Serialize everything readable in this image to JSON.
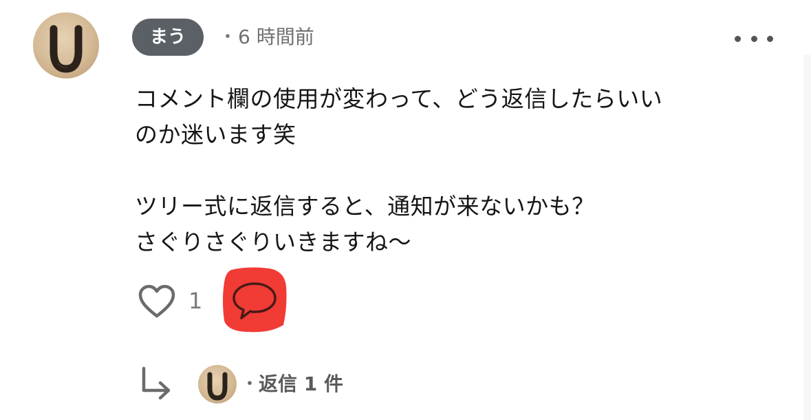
{
  "comment": {
    "username": "まう",
    "meta_separator": "・",
    "timestamp": "6 時間前",
    "more_icon": "more-horizontal-icon",
    "body_lines": [
      "コメント欄の使用が変わって、どう返信したらいい",
      "のか迷います笑",
      "",
      "ツリー式に返信すると、通知が来ないかも？",
      "さぐりさぐりいきますね〜"
    ],
    "like_icon": "heart-outline-icon",
    "like_count": "1",
    "reply_icon": "speech-bubble-icon",
    "reply_highlight_color": "#f0302a"
  },
  "replies": {
    "arrow_icon": "reply-arrow-icon",
    "separator": "・",
    "count_label": "返信 1 件"
  },
  "colors": {
    "username_badge": "#5b6066",
    "icon_gray": "#6b6b6b"
  }
}
